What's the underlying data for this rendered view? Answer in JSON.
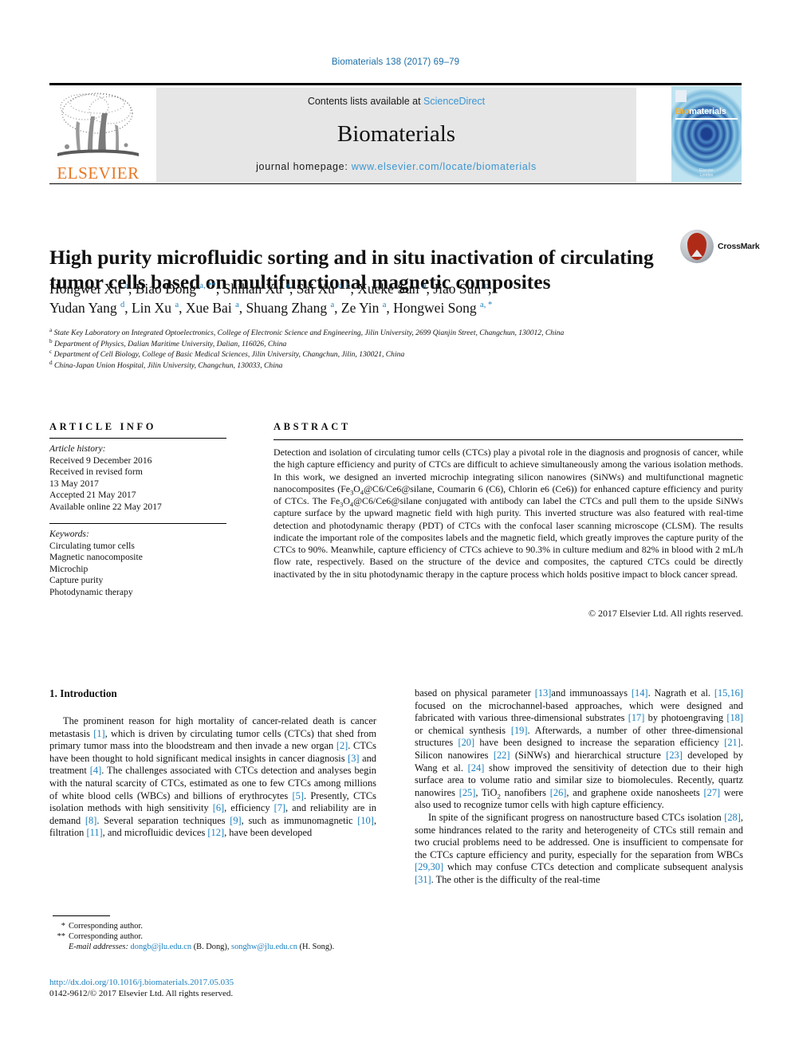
{
  "running_head": "Biomaterials 138 (2017) 69–79",
  "header": {
    "publisher": "ELSEVIER",
    "contents_prefix": "Contents lists available at ",
    "contents_link": "ScienceDirect",
    "journal_name": "Biomaterials",
    "homepage_prefix": "journal homepage: ",
    "homepage_url": "www.elsevier.com/locate/biomaterials",
    "cover_title_part1": "Bio",
    "cover_title_part2": "materials",
    "cover_footer": "Elsevier\nLondon",
    "link_color": "#3c96d2",
    "elsevier_orange": "#e87722"
  },
  "article": {
    "title": "High purity microfluidic sorting and in situ inactivation of circulating tumor cells based on multifunctional magnetic composites",
    "crossmark_label": "CrossMark",
    "authors_line1": "Hongwei Xu <a>, Biao Dong <a, **>, Shihan Xu <a>, Sai Xu <a, b>, Xueke Sun <a>, Jiao Sun <c>,",
    "authors_line2": "Yudan Yang <d>, Lin Xu <a>, Xue Bai <a>, Shuang Zhang <a>, Ze Yin <a>, Hongwei Song <a, *>",
    "authors": [
      {
        "name": "Hongwei Xu",
        "sup": "a"
      },
      {
        "name": "Biao Dong",
        "sup": "a, **"
      },
      {
        "name": "Shihan Xu",
        "sup": "a"
      },
      {
        "name": "Sai Xu",
        "sup": "a, b"
      },
      {
        "name": "Xueke Sun",
        "sup": "a"
      },
      {
        "name": "Jiao Sun",
        "sup": "c"
      },
      {
        "name": "Yudan Yang",
        "sup": "d"
      },
      {
        "name": "Lin Xu",
        "sup": "a"
      },
      {
        "name": "Xue Bai",
        "sup": "a"
      },
      {
        "name": "Shuang Zhang",
        "sup": "a"
      },
      {
        "name": "Ze Yin",
        "sup": "a"
      },
      {
        "name": "Hongwei Song",
        "sup": "a, *"
      }
    ],
    "affiliations": [
      {
        "marker": "a",
        "text": "State Key Laboratory on Integrated Optoelectronics, College of Electronic Science and Engineering, Jilin University, 2699 Qianjin Street, Changchun, 130012, China"
      },
      {
        "marker": "b",
        "text": "Department of Physics, Dalian Maritime University, Dalian, 116026, China"
      },
      {
        "marker": "c",
        "text": "Department of Cell Biology, College of Basic Medical Sciences, Jilin University, Changchun, Jilin, 130021, China"
      },
      {
        "marker": "d",
        "text": "China-Japan Union Hospital, Jilin University, Changchun, 130033, China"
      }
    ]
  },
  "article_info": {
    "heading": "ARTICLE INFO",
    "history_label": "Article history:",
    "history": [
      "Received 9 December 2016",
      "Received in revised form",
      "13 May 2017",
      "Accepted 21 May 2017",
      "Available online 22 May 2017"
    ],
    "keywords_label": "Keywords:",
    "keywords": [
      "Circulating tumor cells",
      "Magnetic nanocomposite",
      "Microchip",
      "Capture purity",
      "Photodynamic therapy"
    ]
  },
  "abstract": {
    "heading": "ABSTRACT",
    "paragraph_part1": "Detection and isolation of circulating tumor cells (CTCs) play a pivotal role in the diagnosis and prognosis of cancer, while the high capture efficiency and purity of CTCs are difficult to achieve simultaneously among the various isolation methods. In this work, we designed an inverted microchip integrating silicon nanowires (SiNWs) and multifunctional magnetic nanocomposites (Fe",
    "sub1": "3",
    "paragraph_part2": "O",
    "sub2": "4",
    "paragraph_part3": "@C6/Ce6@silane, Coumarin 6 (C6), Chlorin e6 (Ce6)) for enhanced capture efficiency and purity of CTCs. The Fe",
    "sub3": "3",
    "paragraph_part4": "O",
    "sub4": "4",
    "paragraph_part5": "@C6/Ce6@silane conjugated with antibody can label the CTCs and pull them to the upside SiNWs capture surface by the upward magnetic field with high purity. This inverted structure was also featured with real-time detection and photodynamic therapy (PDT) of CTCs with the confocal laser scanning microscope (CLSM). The results indicate the important role of the composites labels and the magnetic field, which greatly improves the capture purity of the CTCs to 90%. Meanwhile, capture efficiency of CTCs achieve to 90.3% in culture medium and 82% in blood with 2 mL/h flow rate, respectively. Based on the structure of the device and composites, the captured CTCs could be directly inactivated by the in situ photodynamic therapy in the capture process which holds positive impact to block cancer spread.",
    "copyright": "© 2017 Elsevier Ltd. All rights reserved."
  },
  "introduction": {
    "section_title": "1. Introduction",
    "left_paragraph": "The prominent reason for high mortality of cancer-related death is cancer metastasis [1], which is driven by circulating tumor cells (CTCs) that shed from primary tumor mass into the bloodstream and then invade a new organ [2]. CTCs have been thought to hold significant medical insights in cancer diagnosis [3] and treatment [4]. The challenges associated with CTCs detection and analyses begin with the natural scarcity of CTCs, estimated as one to few CTCs among millions of white blood cells (WBCs) and billions of erythrocytes [5]. Presently, CTCs isolation methods with high sensitivity [6], efficiency [7], and reliability are in demand [8]. Several separation techniques [9], such as immunomagnetic [10], filtration [11], and microfluidic devices [12], have been developed",
    "right_paragraph_1": "based on physical parameter [13]and immunoassays [14]. Nagrath et al. [15,16] focused on the microchannel-based approaches, which were designed and fabricated with various three-dimensional substrates [17] by photoengraving [18] or chemical synthesis [19]. Afterwards, a number of other three-dimensional structures [20] have been designed to increase the separation efficiency [21]. Silicon nanowires [22] (SiNWs) and hierarchical structure [23] developed by Wang et al. [24] show improved the sensitivity of detection due to their high surface area to volume ratio and similar size to biomolecules. Recently, quartz nanowires [25], TiO2 nanofibers [26], and graphene oxide nanosheets [27] were also used to recognize tumor cells with high capture efficiency.",
    "right_paragraph_2": "In spite of the significant progress on nanostructure based CTCs isolation [28], some hindrances related to the rarity and heterogeneity of CTCs still remain and two crucial problems need to be addressed. One is insufficient to compensate for the CTCs capture efficiency and purity, especially for the separation from WBCs [29,30] which may confuse CTCs detection and complicate subsequent analysis [31]. The other is the difficulty of the real-time"
  },
  "footnotes": {
    "corresponding_1_marker": "*",
    "corresponding_1": "Corresponding author.",
    "corresponding_2_marker": "**",
    "corresponding_2": "Corresponding author.",
    "emails_label": "E-mail addresses:",
    "email_1": "dongb@jlu.edu.cn",
    "email_1_owner": "(B. Dong),",
    "email_2": "songhw@jlu.edu.cn",
    "email_2_owner": "(H. Song).",
    "doi_url": "http://dx.doi.org/10.1016/j.biomaterials.2017.05.035",
    "issn_line": "0142-9612/© 2017 Elsevier Ltd. All rights reserved."
  }
}
